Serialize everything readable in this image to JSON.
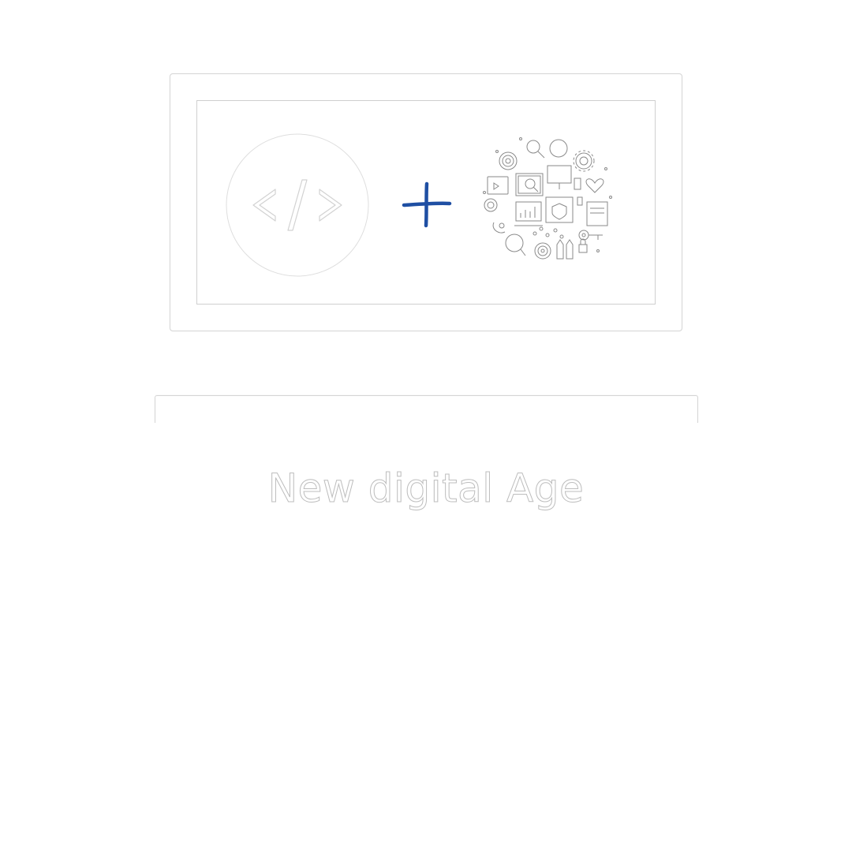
{
  "illustration": {
    "code_symbol": "</>",
    "plus_symbol": "+",
    "colors": {
      "outline": "#c8c8c8",
      "plus_accent": "#1f4fa3",
      "icon_line": "#8a8a8a"
    },
    "icons": [
      "fingerprint-icon",
      "magnifier-icon",
      "gear-icon",
      "laptop-icon",
      "heart-icon",
      "chart-icon",
      "shield-icon",
      "key-icon",
      "pencil-icon",
      "lock-icon"
    ]
  },
  "tagline": {
    "text": "New digital Age"
  }
}
